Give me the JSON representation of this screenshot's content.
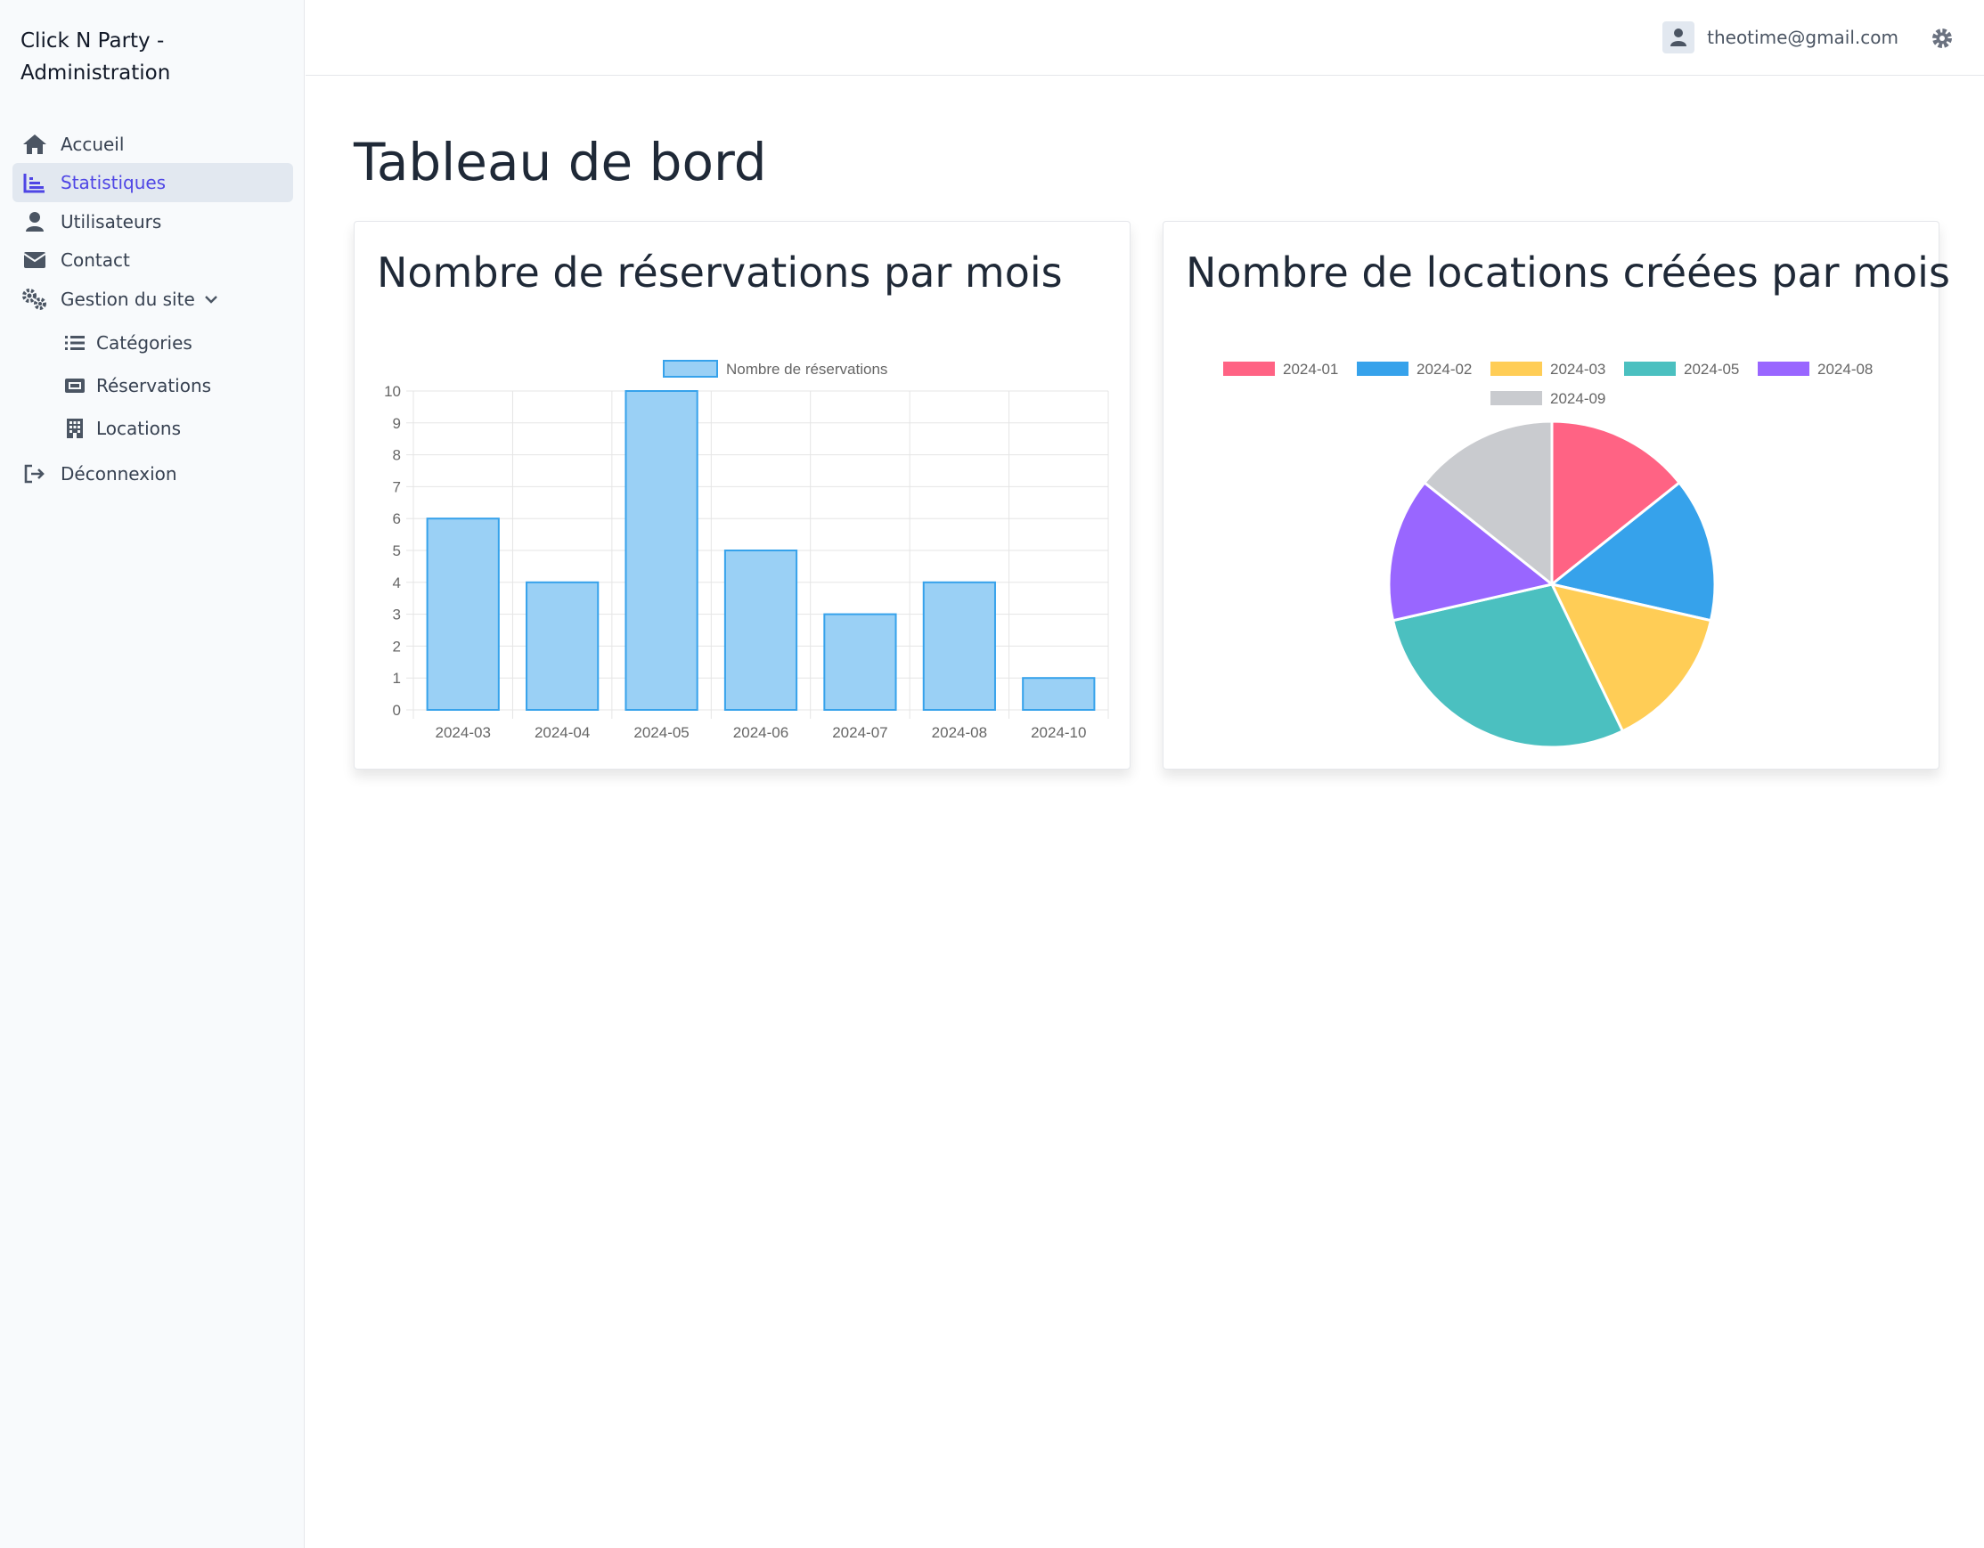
{
  "sidebar": {
    "brand_line1": "Click N Party -",
    "brand_line2": "Administration",
    "items": [
      {
        "label": "Accueil"
      },
      {
        "label": "Statistiques"
      },
      {
        "label": "Utilisateurs"
      },
      {
        "label": "Contact"
      },
      {
        "label": "Gestion du site"
      },
      {
        "label": "Catégories"
      },
      {
        "label": "Réservations"
      },
      {
        "label": "Locations"
      },
      {
        "label": "Déconnexion"
      }
    ],
    "accent_color": "#4f46e5"
  },
  "header": {
    "user_email": "theotime@gmail.com"
  },
  "main": {
    "page_title": "Tableau de bord",
    "card_left_title": "Nombre de réservations par mois",
    "card_right_title": "Nombre de locations créées par mois"
  },
  "chart_data": [
    {
      "type": "bar",
      "categories": [
        "2024-03",
        "2024-04",
        "2024-05",
        "2024-06",
        "2024-07",
        "2024-08",
        "2024-10"
      ],
      "series": [
        {
          "name": "Nombre de réservations",
          "values": [
            6,
            4,
            10,
            5,
            3,
            4,
            1
          ]
        }
      ],
      "ylim": [
        0,
        10
      ],
      "yticks": [
        "0",
        "1",
        "2",
        "3",
        "4",
        "5",
        "6",
        "7",
        "8",
        "9",
        "10"
      ],
      "grid": true,
      "legend": "top-center",
      "fill_color": "#9ad0f5",
      "stroke_color": "#36a2eb"
    },
    {
      "type": "pie",
      "labels": [
        "2024-01",
        "2024-02",
        "2024-03",
        "2024-05",
        "2024-08",
        "2024-09"
      ],
      "values": [
        1,
        1,
        1,
        2,
        1,
        1
      ],
      "colors": [
        "#ff6384",
        "#36a2eb",
        "#ffcd56",
        "#4bc0c0",
        "#9966ff",
        "#c9cbcf"
      ],
      "legend": "top-center"
    }
  ]
}
